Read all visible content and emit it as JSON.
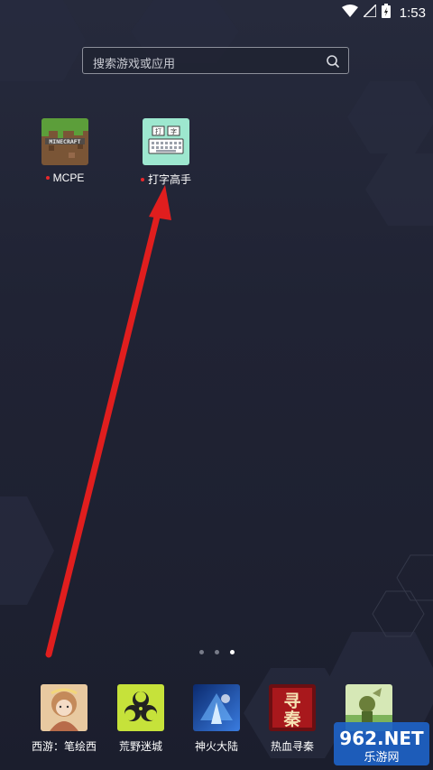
{
  "status_bar": {
    "time": "1:53",
    "icons": [
      "wifi-icon",
      "signal-icon",
      "battery-charging-icon"
    ]
  },
  "search": {
    "placeholder": "搜索游戏或应用",
    "icon": "search-icon"
  },
  "home_apps": [
    {
      "label": "MCPE",
      "icon": "minecraft-icon",
      "has_new_dot": true
    },
    {
      "label": "打字高手",
      "icon": "typing-master-icon",
      "has_new_dot": true
    }
  ],
  "page_indicator": {
    "total": 3,
    "current": 3
  },
  "dock": [
    {
      "label": "西游：笔绘西",
      "icon": "xiyou-icon"
    },
    {
      "label": "荒野迷城",
      "icon": "biohazard-icon"
    },
    {
      "label": "神火大陆",
      "icon": "shenhuo-icon"
    },
    {
      "label": "热血寻秦",
      "icon": "xunqin-icon"
    },
    {
      "label": "",
      "icon": "game-icon"
    }
  ],
  "watermark": {
    "brand": "962.NET",
    "subtitle": "乐游网"
  },
  "colors": {
    "accent_red": "#e8282c",
    "arrow_red": "#e01e1e",
    "background": "#202334"
  }
}
